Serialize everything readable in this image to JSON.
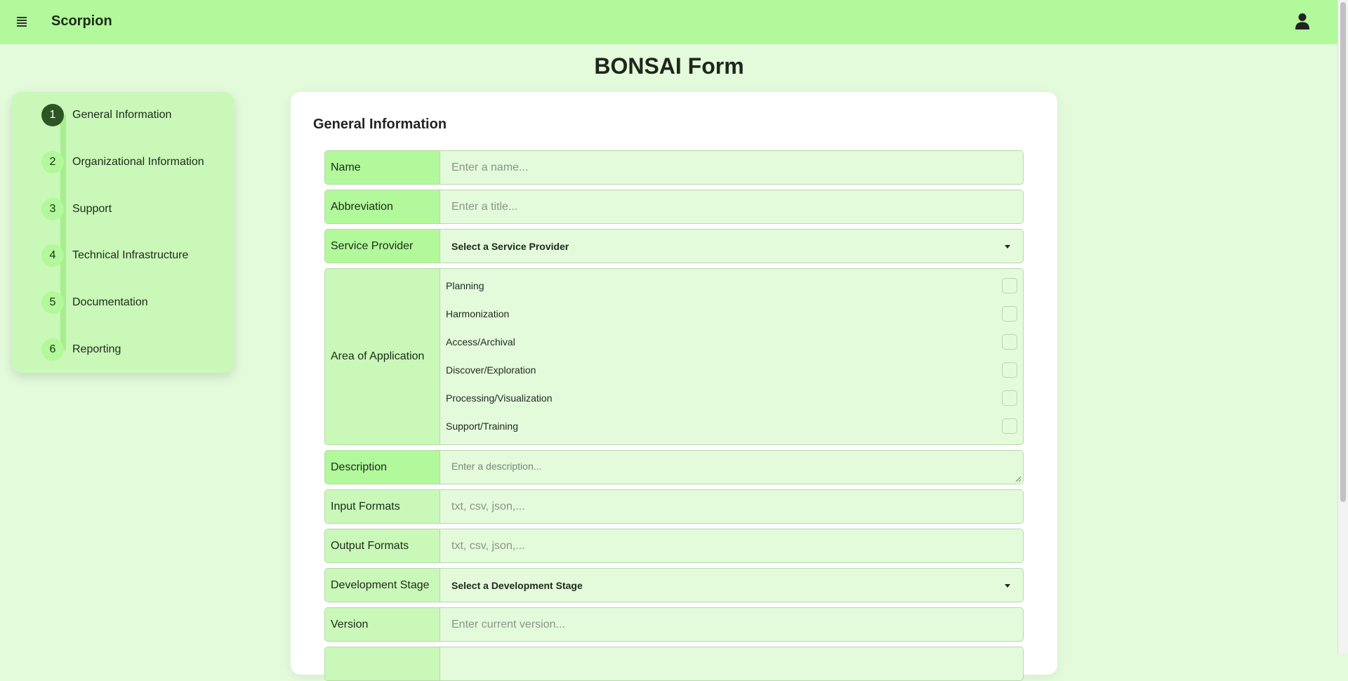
{
  "header": {
    "app_name": "Scorpion",
    "menu_icon": "hamburger-menu-icon",
    "user_icon": "user-account-icon",
    "bg_color": "#b1f99a"
  },
  "page": {
    "title": "BONSAI Form",
    "bg_color": "#e3fadb"
  },
  "stepper": {
    "active_step": 1,
    "steps": [
      {
        "number": "1",
        "label": "General Information"
      },
      {
        "number": "2",
        "label": "Organizational Information"
      },
      {
        "number": "3",
        "label": "Support"
      },
      {
        "number": "4",
        "label": "Technical Infrastructure"
      },
      {
        "number": "5",
        "label": "Documentation"
      },
      {
        "number": "6",
        "label": "Reporting"
      }
    ]
  },
  "form": {
    "section_title": "General Information",
    "name": {
      "label": "Name",
      "placeholder": "Enter a name...",
      "value": ""
    },
    "abbreviation": {
      "label": "Abbreviation",
      "placeholder": "Enter a title...",
      "value": ""
    },
    "service_provider": {
      "label": "Service Provider",
      "selected": "Select a Service Provider"
    },
    "area_of_application": {
      "label": "Area of Application",
      "options": [
        {
          "label": "Planning",
          "checked": false
        },
        {
          "label": "Harmonization",
          "checked": false
        },
        {
          "label": "Access/Archival",
          "checked": false
        },
        {
          "label": "Discover/Exploration",
          "checked": false
        },
        {
          "label": "Processing/Visualization",
          "checked": false
        },
        {
          "label": "Support/Training",
          "checked": false
        }
      ]
    },
    "description": {
      "label": "Description",
      "placeholder": "Enter a description...",
      "value": ""
    },
    "input_formats": {
      "label": "Input Formats",
      "placeholder": "txt, csv, json,...",
      "value": ""
    },
    "output_formats": {
      "label": "Output Formats",
      "placeholder": "txt, csv, json,...",
      "value": ""
    },
    "development_stage": {
      "label": "Development Stage",
      "selected": "Select a Development Stage"
    },
    "version": {
      "label": "Version",
      "placeholder": "Enter current version...",
      "value": ""
    }
  }
}
